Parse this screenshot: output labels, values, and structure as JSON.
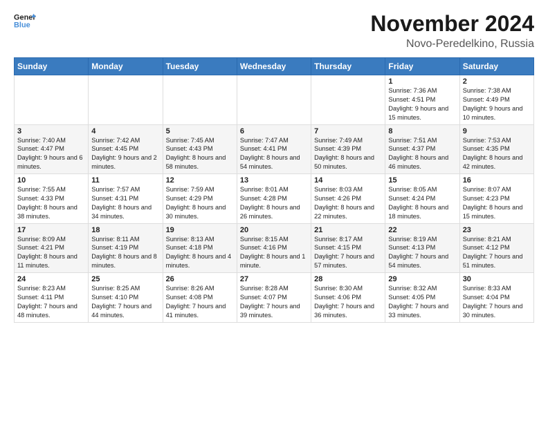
{
  "logo": {
    "line1": "General",
    "line2": "Blue"
  },
  "title": "November 2024",
  "subtitle": "Novo-Peredelkino, Russia",
  "headers": [
    "Sunday",
    "Monday",
    "Tuesday",
    "Wednesday",
    "Thursday",
    "Friday",
    "Saturday"
  ],
  "weeks": [
    [
      {
        "day": "",
        "info": ""
      },
      {
        "day": "",
        "info": ""
      },
      {
        "day": "",
        "info": ""
      },
      {
        "day": "",
        "info": ""
      },
      {
        "day": "",
        "info": ""
      },
      {
        "day": "1",
        "info": "Sunrise: 7:36 AM\nSunset: 4:51 PM\nDaylight: 9 hours and 15 minutes."
      },
      {
        "day": "2",
        "info": "Sunrise: 7:38 AM\nSunset: 4:49 PM\nDaylight: 9 hours and 10 minutes."
      }
    ],
    [
      {
        "day": "3",
        "info": "Sunrise: 7:40 AM\nSunset: 4:47 PM\nDaylight: 9 hours and 6 minutes."
      },
      {
        "day": "4",
        "info": "Sunrise: 7:42 AM\nSunset: 4:45 PM\nDaylight: 9 hours and 2 minutes."
      },
      {
        "day": "5",
        "info": "Sunrise: 7:45 AM\nSunset: 4:43 PM\nDaylight: 8 hours and 58 minutes."
      },
      {
        "day": "6",
        "info": "Sunrise: 7:47 AM\nSunset: 4:41 PM\nDaylight: 8 hours and 54 minutes."
      },
      {
        "day": "7",
        "info": "Sunrise: 7:49 AM\nSunset: 4:39 PM\nDaylight: 8 hours and 50 minutes."
      },
      {
        "day": "8",
        "info": "Sunrise: 7:51 AM\nSunset: 4:37 PM\nDaylight: 8 hours and 46 minutes."
      },
      {
        "day": "9",
        "info": "Sunrise: 7:53 AM\nSunset: 4:35 PM\nDaylight: 8 hours and 42 minutes."
      }
    ],
    [
      {
        "day": "10",
        "info": "Sunrise: 7:55 AM\nSunset: 4:33 PM\nDaylight: 8 hours and 38 minutes."
      },
      {
        "day": "11",
        "info": "Sunrise: 7:57 AM\nSunset: 4:31 PM\nDaylight: 8 hours and 34 minutes."
      },
      {
        "day": "12",
        "info": "Sunrise: 7:59 AM\nSunset: 4:29 PM\nDaylight: 8 hours and 30 minutes."
      },
      {
        "day": "13",
        "info": "Sunrise: 8:01 AM\nSunset: 4:28 PM\nDaylight: 8 hours and 26 minutes."
      },
      {
        "day": "14",
        "info": "Sunrise: 8:03 AM\nSunset: 4:26 PM\nDaylight: 8 hours and 22 minutes."
      },
      {
        "day": "15",
        "info": "Sunrise: 8:05 AM\nSunset: 4:24 PM\nDaylight: 8 hours and 18 minutes."
      },
      {
        "day": "16",
        "info": "Sunrise: 8:07 AM\nSunset: 4:23 PM\nDaylight: 8 hours and 15 minutes."
      }
    ],
    [
      {
        "day": "17",
        "info": "Sunrise: 8:09 AM\nSunset: 4:21 PM\nDaylight: 8 hours and 11 minutes."
      },
      {
        "day": "18",
        "info": "Sunrise: 8:11 AM\nSunset: 4:19 PM\nDaylight: 8 hours and 8 minutes."
      },
      {
        "day": "19",
        "info": "Sunrise: 8:13 AM\nSunset: 4:18 PM\nDaylight: 8 hours and 4 minutes."
      },
      {
        "day": "20",
        "info": "Sunrise: 8:15 AM\nSunset: 4:16 PM\nDaylight: 8 hours and 1 minute."
      },
      {
        "day": "21",
        "info": "Sunrise: 8:17 AM\nSunset: 4:15 PM\nDaylight: 7 hours and 57 minutes."
      },
      {
        "day": "22",
        "info": "Sunrise: 8:19 AM\nSunset: 4:13 PM\nDaylight: 7 hours and 54 minutes."
      },
      {
        "day": "23",
        "info": "Sunrise: 8:21 AM\nSunset: 4:12 PM\nDaylight: 7 hours and 51 minutes."
      }
    ],
    [
      {
        "day": "24",
        "info": "Sunrise: 8:23 AM\nSunset: 4:11 PM\nDaylight: 7 hours and 48 minutes."
      },
      {
        "day": "25",
        "info": "Sunrise: 8:25 AM\nSunset: 4:10 PM\nDaylight: 7 hours and 44 minutes."
      },
      {
        "day": "26",
        "info": "Sunrise: 8:26 AM\nSunset: 4:08 PM\nDaylight: 7 hours and 41 minutes."
      },
      {
        "day": "27",
        "info": "Sunrise: 8:28 AM\nSunset: 4:07 PM\nDaylight: 7 hours and 39 minutes."
      },
      {
        "day": "28",
        "info": "Sunrise: 8:30 AM\nSunset: 4:06 PM\nDaylight: 7 hours and 36 minutes."
      },
      {
        "day": "29",
        "info": "Sunrise: 8:32 AM\nSunset: 4:05 PM\nDaylight: 7 hours and 33 minutes."
      },
      {
        "day": "30",
        "info": "Sunrise: 8:33 AM\nSunset: 4:04 PM\nDaylight: 7 hours and 30 minutes."
      }
    ]
  ]
}
